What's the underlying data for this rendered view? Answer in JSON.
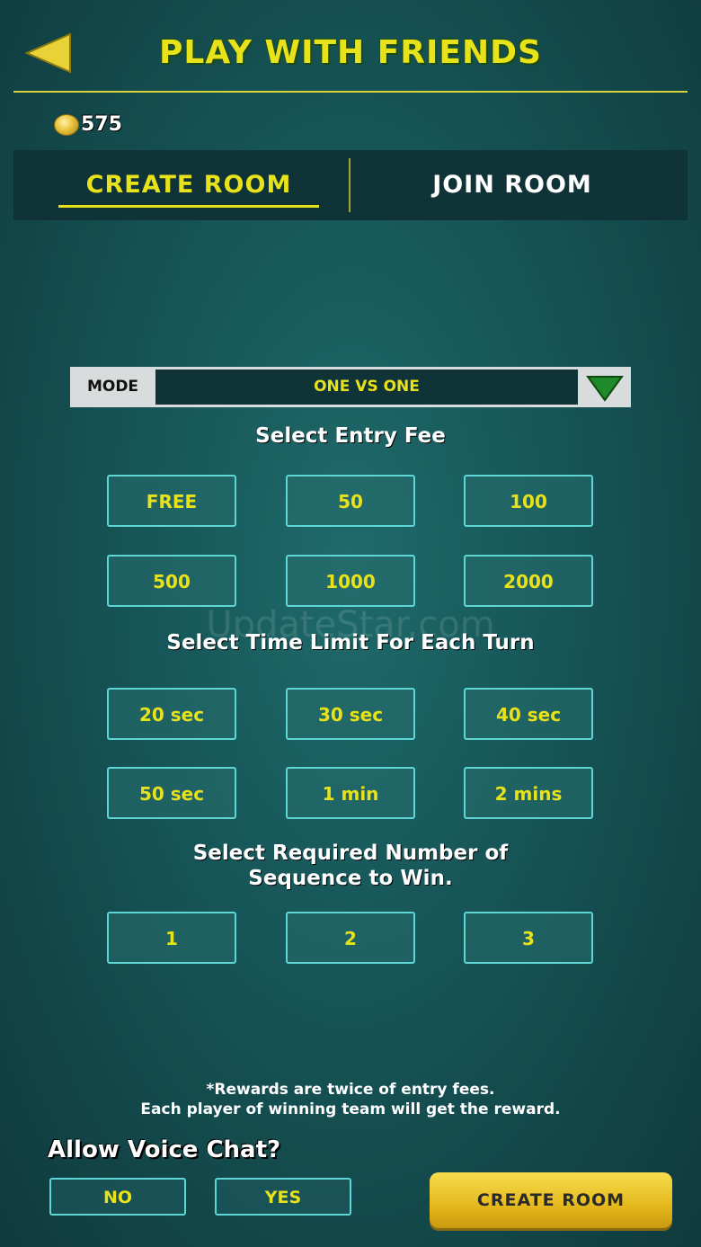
{
  "header": {
    "title": "PLAY WITH FRIENDS",
    "back_icon": "back-triangle-icon"
  },
  "coins": {
    "icon": "coin-icon",
    "count": "575"
  },
  "tabs": [
    {
      "label": "CREATE ROOM",
      "active": true
    },
    {
      "label": "JOIN ROOM",
      "active": false
    }
  ],
  "mode": {
    "label": "MODE",
    "value": "ONE VS ONE",
    "dropdown_icon": "dropdown-arrow-icon"
  },
  "entry_fee": {
    "title": "Select Entry Fee",
    "options": [
      "FREE",
      "50",
      "100",
      "500",
      "1000",
      "2000"
    ]
  },
  "watermark": "UpdateStar.com",
  "time_limit": {
    "title": "Select Time Limit For Each Turn",
    "options": [
      "20 sec",
      "30 sec",
      "40 sec",
      "50 sec",
      "1 min",
      "2 mins"
    ]
  },
  "sequence": {
    "title_line1": "Select Required Number of",
    "title_line2": "Sequence to Win.",
    "options": [
      "1",
      "2",
      "3"
    ]
  },
  "note": {
    "line1": "*Rewards are twice of entry fees.",
    "line2": "Each player of winning team will get the reward."
  },
  "voice_chat": {
    "title": "Allow Voice Chat?",
    "no": "NO",
    "yes": "YES"
  },
  "create_button": "CREATE ROOM",
  "colors": {
    "accent": "#e8e21a",
    "border": "#5fd6d6",
    "bg": "#165456",
    "button": "#e5b91c"
  }
}
